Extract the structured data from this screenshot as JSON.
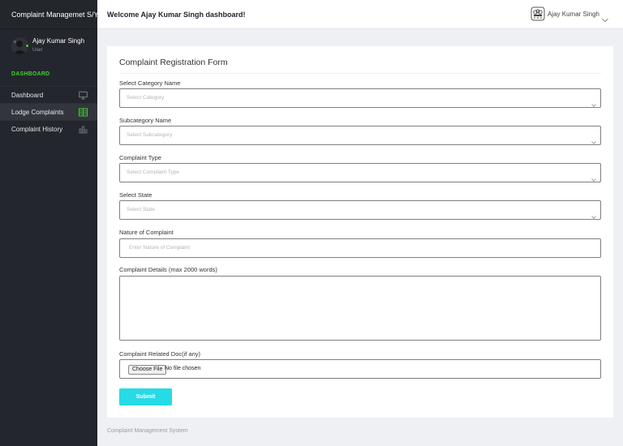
{
  "sidebar": {
    "brand": "Complaint Managemet S/Y",
    "profile": {
      "name": "Ajay Kumar Singh",
      "role": "User",
      "status": "online"
    },
    "section_label": "DASHBOARD",
    "items": [
      {
        "label": "Dashboard",
        "icon": "monitor-icon",
        "active": false
      },
      {
        "label": "Lodge Complaints",
        "icon": "book-icon",
        "active": true
      },
      {
        "label": "Complaint History",
        "icon": "bar-chart-icon",
        "active": false
      }
    ]
  },
  "header": {
    "welcome": "Welcome Ajay Kumar Singh dashboard!",
    "user_name": "Ajay Kumar Singh",
    "emblem_icon": "national-emblem-icon",
    "menu_icon": "chevron-down-icon"
  },
  "form": {
    "title": "Complaint Registration Form",
    "category": {
      "label": "Select Category Name",
      "placeholder": "Select Category"
    },
    "subcategory": {
      "label": "Subcategory Name",
      "placeholder": "Select Subcategory"
    },
    "complaint_type": {
      "label": "Complaint Type",
      "placeholder": "Select Complaint Type"
    },
    "state": {
      "label": "Select State",
      "placeholder": "Select State"
    },
    "nature": {
      "label": "Nature of Complaint",
      "placeholder": "Enter Nature of Complaint"
    },
    "details": {
      "label": "Complaint Details (max 2000 words)",
      "value": ""
    },
    "doc": {
      "label": "Complaint Related Doc(if any)",
      "button": "Choose File",
      "status": "No file chosen"
    },
    "submit_label": "Submit"
  },
  "footer": {
    "text": "Complaint Management System"
  },
  "colors": {
    "sidebar_bg": "#24262d",
    "accent_green": "#3fd12b",
    "submit_bg": "#26dbe6",
    "page_bg": "#eef0f4"
  }
}
